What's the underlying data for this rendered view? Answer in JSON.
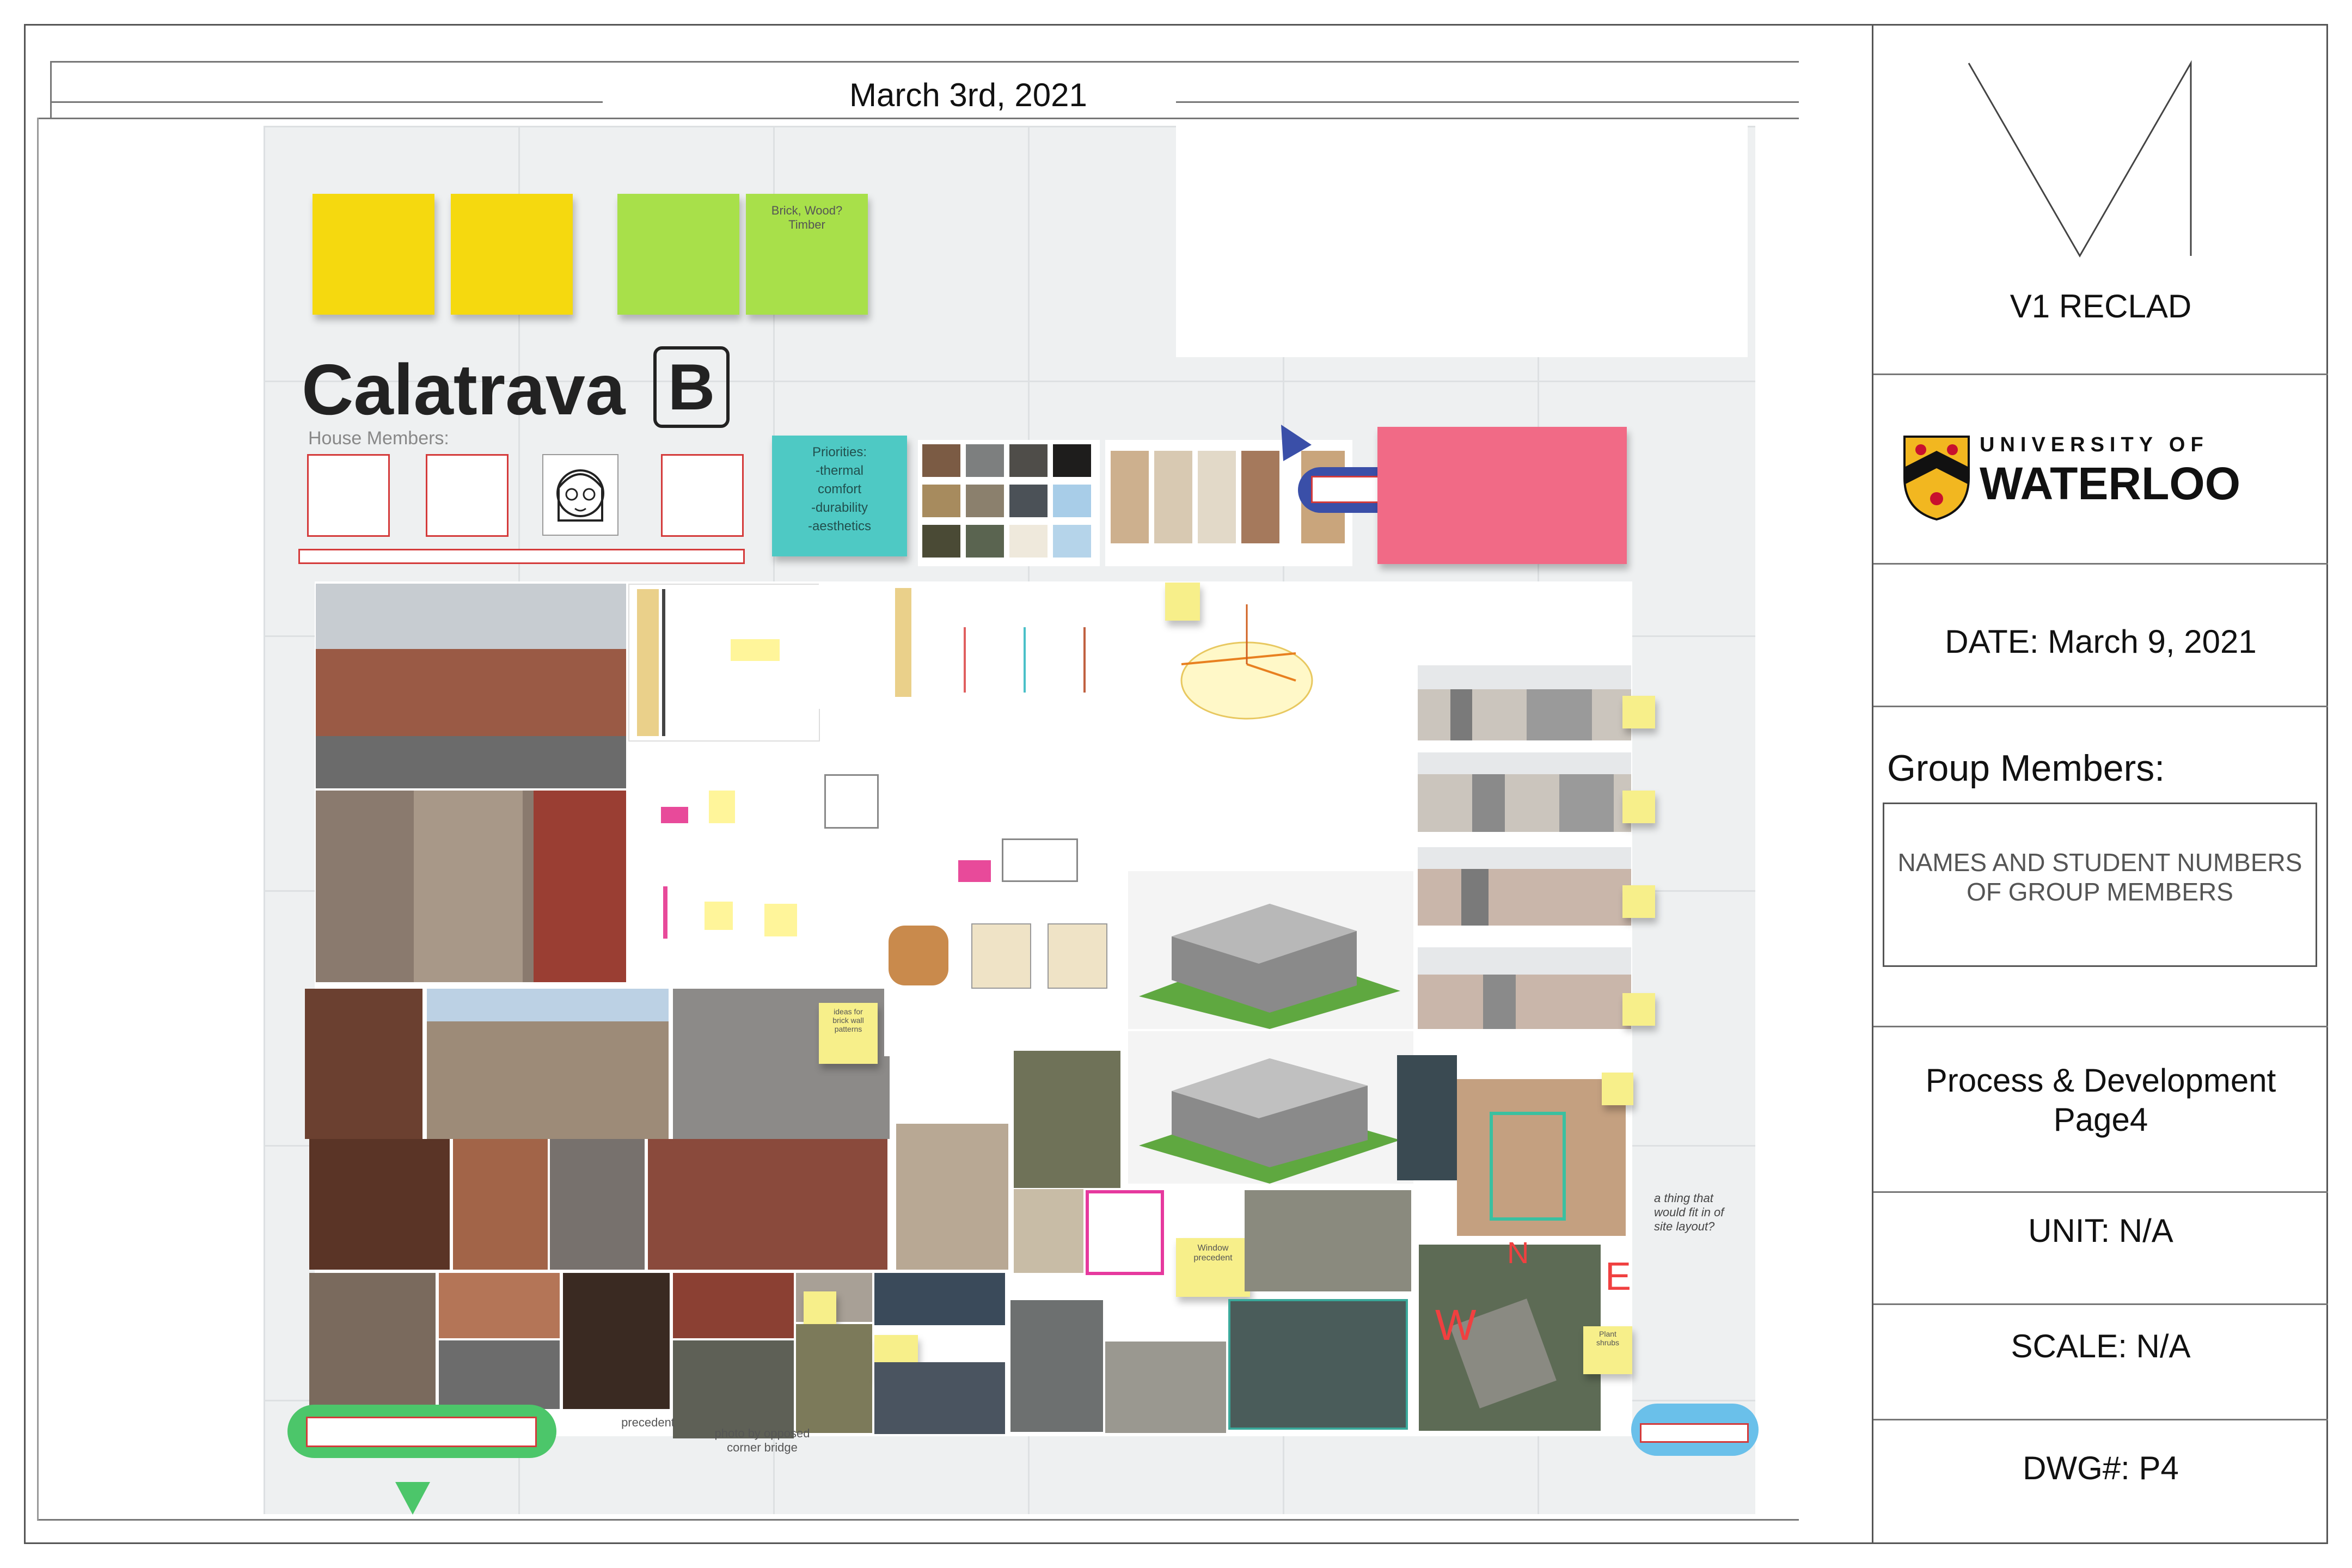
{
  "header": {
    "date": "March 3rd, 2021"
  },
  "board": {
    "title": "Calatrava",
    "title_letter": "B",
    "house_members_label": "House Members:",
    "priorities_note": "Priorities:\n-thermal\ncomfort\n-durability\n-aesthetics",
    "green_note_text": "Brick, Wood?\nTimber",
    "yellow_note_window": "Window\nprecedent",
    "yellow_note_brick": "ideas for\nbrick wall\npatterns",
    "yellow_note_east": "Plant\nshrubs",
    "caption_1": "precedent",
    "caption_2": "photo by opposed\ncorner bridge",
    "compass_labels": [
      "W",
      "N",
      "E"
    ],
    "handwritten_annot": "a thing that\nwould fit in of\nsite layout?"
  },
  "title_block": {
    "project": "V1 RECLAD",
    "university_line1": "UNIVERSITY OF",
    "university_line2": "WATERLOO",
    "date": "DATE: March 9, 2021",
    "group_members_label": "Group Members:",
    "group_members_placeholder": "NAMES AND STUDENT NUMBERS OF GROUP MEMBERS",
    "sheet_title_line1": "Process & Development",
    "sheet_title_line2": "Page4",
    "unit": "UNIT: N/A",
    "scale": "SCALE: N/A",
    "dwg": "DWG#: P4"
  },
  "colors": {
    "sticky_yellow": "#f5d90f",
    "sticky_green": "#a8e04a",
    "sticky_teal": "#4ec9c4",
    "sticky_pink": "#f16a86",
    "accent_blue": "#3a4fa8",
    "accent_green": "#4cc66a",
    "logo_red": "#c8102e",
    "logo_gold": "#f2b720"
  }
}
